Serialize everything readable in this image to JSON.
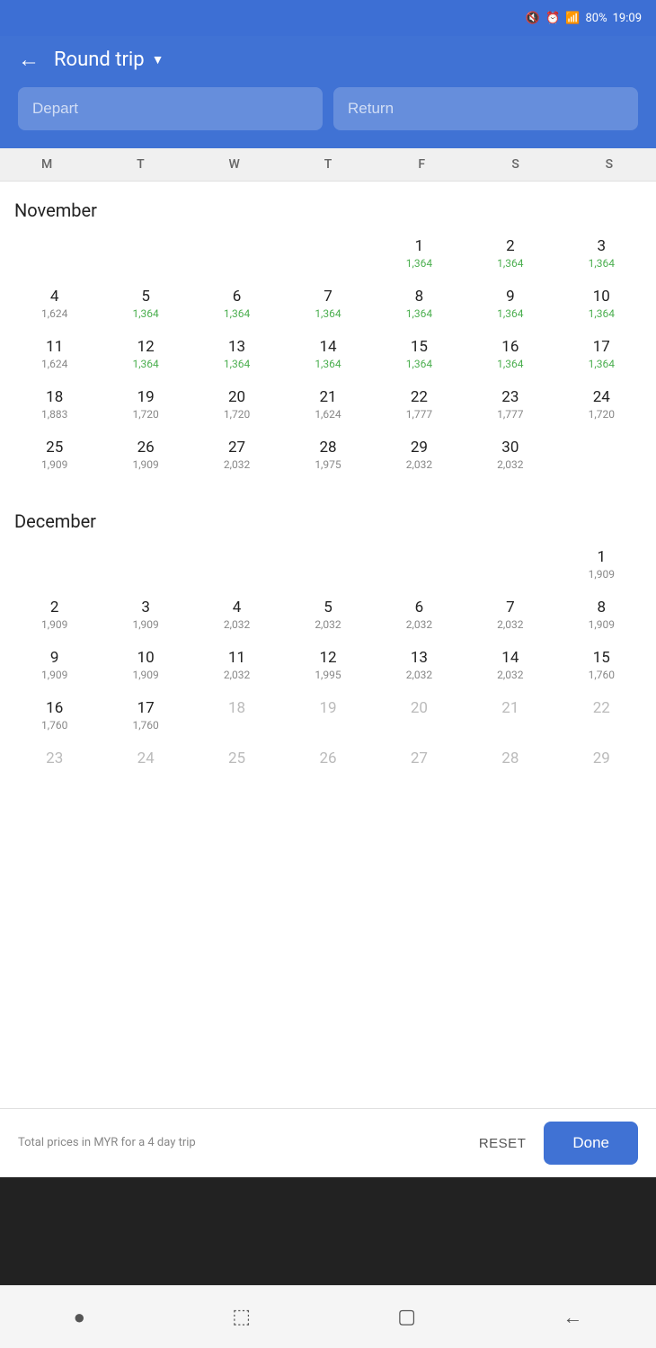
{
  "statusBar": {
    "battery": "80%",
    "time": "19:09"
  },
  "header": {
    "tripType": "Round trip",
    "departPlaceholder": "Depart",
    "returnPlaceholder": "Return"
  },
  "calendar": {
    "dayHeaders": [
      "M",
      "T",
      "W",
      "T",
      "F",
      "S",
      "S"
    ],
    "months": [
      {
        "name": "November",
        "startDayOfWeek": 4,
        "days": [
          {
            "day": "",
            "price": "",
            "green": false,
            "greyed": false
          },
          {
            "day": "",
            "price": "",
            "green": false,
            "greyed": false
          },
          {
            "day": "",
            "price": "",
            "green": false,
            "greyed": false
          },
          {
            "day": "",
            "price": "",
            "green": false,
            "greyed": false
          },
          {
            "day": "1",
            "price": "1,364",
            "green": true,
            "greyed": false
          },
          {
            "day": "2",
            "price": "1,364",
            "green": true,
            "greyed": false
          },
          {
            "day": "3",
            "price": "1,364",
            "green": true,
            "greyed": false
          },
          {
            "day": "4",
            "price": "1,624",
            "green": false,
            "greyed": false
          },
          {
            "day": "5",
            "price": "1,364",
            "green": true,
            "greyed": false
          },
          {
            "day": "6",
            "price": "1,364",
            "green": true,
            "greyed": false
          },
          {
            "day": "7",
            "price": "1,364",
            "green": true,
            "greyed": false
          },
          {
            "day": "8",
            "price": "1,364",
            "green": true,
            "greyed": false
          },
          {
            "day": "9",
            "price": "1,364",
            "green": true,
            "greyed": false
          },
          {
            "day": "10",
            "price": "1,364",
            "green": true,
            "greyed": false
          },
          {
            "day": "11",
            "price": "1,624",
            "green": false,
            "greyed": false
          },
          {
            "day": "12",
            "price": "1,364",
            "green": true,
            "greyed": false
          },
          {
            "day": "13",
            "price": "1,364",
            "green": true,
            "greyed": false
          },
          {
            "day": "14",
            "price": "1,364",
            "green": true,
            "greyed": false
          },
          {
            "day": "15",
            "price": "1,364",
            "green": true,
            "greyed": false
          },
          {
            "day": "16",
            "price": "1,364",
            "green": true,
            "greyed": false
          },
          {
            "day": "17",
            "price": "1,364",
            "green": true,
            "greyed": false
          },
          {
            "day": "18",
            "price": "1,883",
            "green": false,
            "greyed": false
          },
          {
            "day": "19",
            "price": "1,720",
            "green": false,
            "greyed": false
          },
          {
            "day": "20",
            "price": "1,720",
            "green": false,
            "greyed": false
          },
          {
            "day": "21",
            "price": "1,624",
            "green": false,
            "greyed": false
          },
          {
            "day": "22",
            "price": "1,777",
            "green": false,
            "greyed": false
          },
          {
            "day": "23",
            "price": "1,777",
            "green": false,
            "greyed": false
          },
          {
            "day": "24",
            "price": "1,720",
            "green": false,
            "greyed": false
          },
          {
            "day": "25",
            "price": "1,909",
            "green": false,
            "greyed": false
          },
          {
            "day": "26",
            "price": "1,909",
            "green": false,
            "greyed": false
          },
          {
            "day": "27",
            "price": "2,032",
            "green": false,
            "greyed": false
          },
          {
            "day": "28",
            "price": "1,975",
            "green": false,
            "greyed": false
          },
          {
            "day": "29",
            "price": "2,032",
            "green": false,
            "greyed": false
          },
          {
            "day": "30",
            "price": "2,032",
            "green": false,
            "greyed": false
          },
          {
            "day": "",
            "price": "",
            "green": false,
            "greyed": false
          }
        ]
      },
      {
        "name": "December",
        "startDayOfWeek": 0,
        "days": [
          {
            "day": "",
            "price": "",
            "green": false,
            "greyed": false
          },
          {
            "day": "",
            "price": "",
            "green": false,
            "greyed": false
          },
          {
            "day": "",
            "price": "",
            "green": false,
            "greyed": false
          },
          {
            "day": "",
            "price": "",
            "green": false,
            "greyed": false
          },
          {
            "day": "",
            "price": "",
            "green": false,
            "greyed": false
          },
          {
            "day": "",
            "price": "",
            "green": false,
            "greyed": false
          },
          {
            "day": "1",
            "price": "1,909",
            "green": false,
            "greyed": false
          },
          {
            "day": "2",
            "price": "1,909",
            "green": false,
            "greyed": false
          },
          {
            "day": "3",
            "price": "1,909",
            "green": false,
            "greyed": false
          },
          {
            "day": "4",
            "price": "2,032",
            "green": false,
            "greyed": false
          },
          {
            "day": "5",
            "price": "2,032",
            "green": false,
            "greyed": false
          },
          {
            "day": "6",
            "price": "2,032",
            "green": false,
            "greyed": false
          },
          {
            "day": "7",
            "price": "2,032",
            "green": false,
            "greyed": false
          },
          {
            "day": "8",
            "price": "1,909",
            "green": false,
            "greyed": false
          },
          {
            "day": "9",
            "price": "1,909",
            "green": false,
            "greyed": false
          },
          {
            "day": "10",
            "price": "1,909",
            "green": false,
            "greyed": false
          },
          {
            "day": "11",
            "price": "2,032",
            "green": false,
            "greyed": false
          },
          {
            "day": "12",
            "price": "1,995",
            "green": false,
            "greyed": false
          },
          {
            "day": "13",
            "price": "2,032",
            "green": false,
            "greyed": false
          },
          {
            "day": "14",
            "price": "2,032",
            "green": false,
            "greyed": false
          },
          {
            "day": "15",
            "price": "1,760",
            "green": false,
            "greyed": false
          },
          {
            "day": "16",
            "price": "1,760",
            "green": false,
            "greyed": false
          },
          {
            "day": "17",
            "price": "1,760",
            "green": false,
            "greyed": false
          },
          {
            "day": "18",
            "price": "",
            "green": false,
            "greyed": true
          },
          {
            "day": "19",
            "price": "",
            "green": false,
            "greyed": true
          },
          {
            "day": "20",
            "price": "",
            "green": false,
            "greyed": true
          },
          {
            "day": "21",
            "price": "",
            "green": false,
            "greyed": true
          },
          {
            "day": "22",
            "price": "",
            "green": false,
            "greyed": true
          },
          {
            "day": "23",
            "price": "",
            "green": false,
            "greyed": true
          },
          {
            "day": "24",
            "price": "",
            "green": false,
            "greyed": true
          },
          {
            "day": "25",
            "price": "",
            "green": false,
            "greyed": true
          },
          {
            "day": "26",
            "price": "",
            "green": false,
            "greyed": true
          },
          {
            "day": "27",
            "price": "",
            "green": false,
            "greyed": true
          },
          {
            "day": "28",
            "price": "",
            "green": false,
            "greyed": true
          },
          {
            "day": "29",
            "price": "",
            "green": false,
            "greyed": true
          }
        ]
      }
    ]
  },
  "footer": {
    "note": "Total prices in MYR for a 4 day trip",
    "resetLabel": "RESET",
    "doneLabel": "Done"
  }
}
